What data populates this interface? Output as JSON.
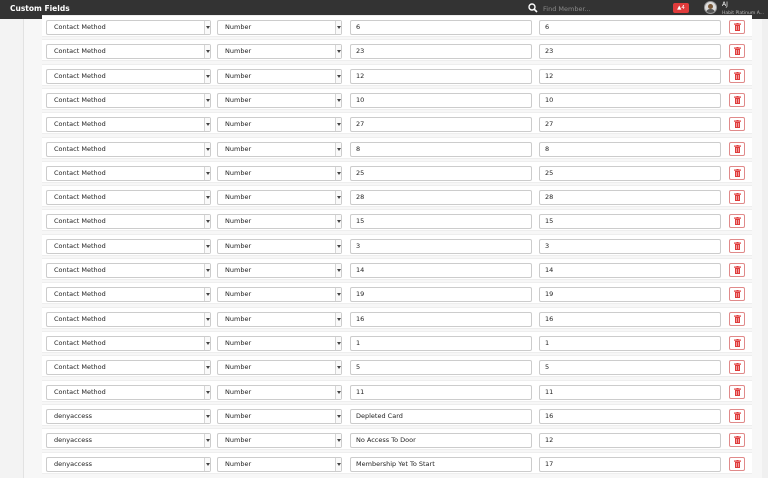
{
  "header": {
    "title": "Custom Fields",
    "search_placeholder": "Find Member...",
    "alert_count": "4",
    "user_initials": "AJ",
    "user_org": "Habit Platinum A..."
  },
  "colors": {
    "topbar": "#333333",
    "danger": "#e03b3b",
    "delete_border": "#e08a8a"
  },
  "rows": [
    {
      "method": "Contact Method",
      "type": "Number",
      "label": "6",
      "value": "6"
    },
    {
      "method": "Contact Method",
      "type": "Number",
      "label": "23",
      "value": "23"
    },
    {
      "method": "Contact Method",
      "type": "Number",
      "label": "12",
      "value": "12"
    },
    {
      "method": "Contact Method",
      "type": "Number",
      "label": "10",
      "value": "10"
    },
    {
      "method": "Contact Method",
      "type": "Number",
      "label": "27",
      "value": "27"
    },
    {
      "method": "Contact Method",
      "type": "Number",
      "label": "8",
      "value": "8"
    },
    {
      "method": "Contact Method",
      "type": "Number",
      "label": "25",
      "value": "25"
    },
    {
      "method": "Contact Method",
      "type": "Number",
      "label": "28",
      "value": "28"
    },
    {
      "method": "Contact Method",
      "type": "Number",
      "label": "15",
      "value": "15"
    },
    {
      "method": "Contact Method",
      "type": "Number",
      "label": "3",
      "value": "3"
    },
    {
      "method": "Contact Method",
      "type": "Number",
      "label": "14",
      "value": "14"
    },
    {
      "method": "Contact Method",
      "type": "Number",
      "label": "19",
      "value": "19"
    },
    {
      "method": "Contact Method",
      "type": "Number",
      "label": "16",
      "value": "16"
    },
    {
      "method": "Contact Method",
      "type": "Number",
      "label": "1",
      "value": "1"
    },
    {
      "method": "Contact Method",
      "type": "Number",
      "label": "5",
      "value": "5"
    },
    {
      "method": "Contact Method",
      "type": "Number",
      "label": "11",
      "value": "11"
    },
    {
      "method": "denyaccess",
      "type": "Number",
      "label": "Depleted Card",
      "value": "16"
    },
    {
      "method": "denyaccess",
      "type": "Number",
      "label": "No Access To Door",
      "value": "12"
    },
    {
      "method": "denyaccess",
      "type": "Number",
      "label": "Membership Yet To Start",
      "value": "17"
    }
  ]
}
